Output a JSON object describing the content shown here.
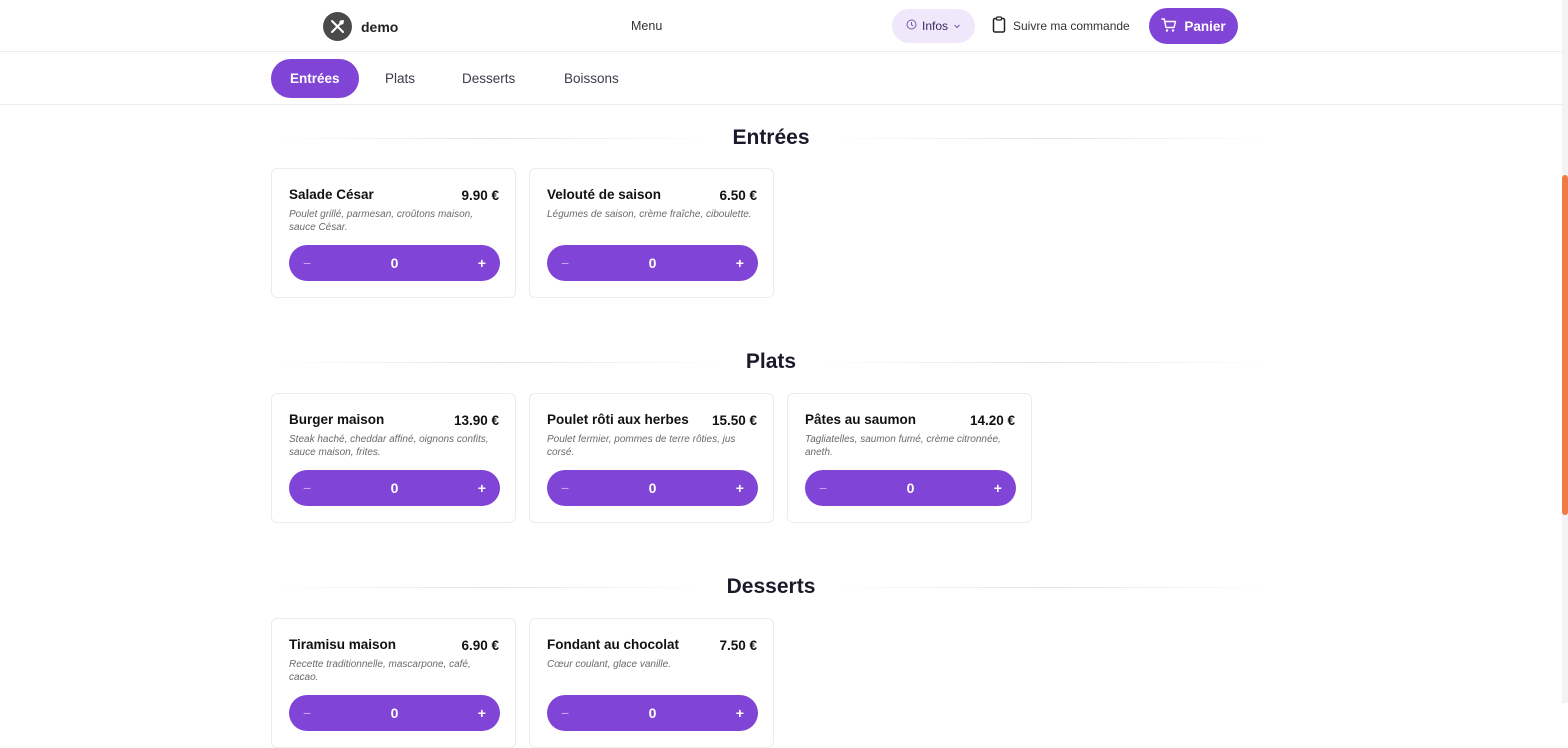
{
  "header": {
    "brand": "demo",
    "menu_link": "Menu",
    "infos_label": "Infos",
    "track_label": "Suivre ma commande",
    "cart_label": "Panier"
  },
  "tabs": [
    {
      "label": "Entrées",
      "active": true
    },
    {
      "label": "Plats",
      "active": false
    },
    {
      "label": "Desserts",
      "active": false
    },
    {
      "label": "Boissons",
      "active": false
    }
  ],
  "sections": [
    {
      "title": "Entrées",
      "items": [
        {
          "name": "Salade César",
          "price": "9.90 €",
          "description": "Poulet grillé, parmesan, croûtons maison, sauce César.",
          "qty": "0"
        },
        {
          "name": "Velouté de saison",
          "price": "6.50 €",
          "description": "Légumes de saison, crème fraîche, ciboulette.",
          "qty": "0"
        }
      ]
    },
    {
      "title": "Plats",
      "items": [
        {
          "name": "Burger maison",
          "price": "13.90 €",
          "description": "Steak haché, cheddar affiné, oignons confits, sauce maison, frites.",
          "qty": "0"
        },
        {
          "name": "Poulet rôti aux herbes",
          "price": "15.50 €",
          "description": "Poulet fermier, pommes de terre rôties, jus corsé.",
          "qty": "0"
        },
        {
          "name": "Pâtes au saumon",
          "price": "14.20 €",
          "description": "Tagliatelles, saumon fumé, crème citronnée, aneth.",
          "qty": "0"
        }
      ]
    },
    {
      "title": "Desserts",
      "items": [
        {
          "name": "Tiramisu maison",
          "price": "6.90 €",
          "description": "Recette traditionnelle, mascarpone, café, cacao.",
          "qty": "0"
        },
        {
          "name": "Fondant au chocolat",
          "price": "7.50 €",
          "description": "Cœur coulant, glace vanille.",
          "qty": "0"
        }
      ]
    }
  ],
  "stepper_symbols": {
    "minus": "−",
    "plus": "+"
  },
  "colors": {
    "accent": "#8044d6",
    "accent_light": "#efe8fa",
    "scroll_thumb": "#f07a45"
  },
  "icons": {
    "logo": "utensils-icon",
    "infos": "clock-icon",
    "infos_caret": "chevron-down-icon",
    "track": "clipboard-icon",
    "cart": "cart-icon"
  }
}
